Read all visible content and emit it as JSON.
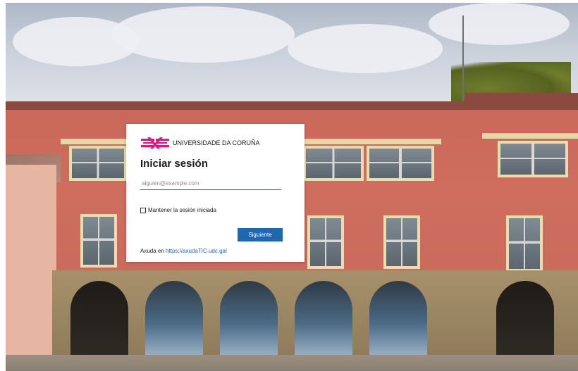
{
  "branding": {
    "university_name": "UNIVERSIDADE DA CORUÑA",
    "logo_color": "#e5127d"
  },
  "login": {
    "title": "Iniciar sesión",
    "email_placeholder": "alguien@example.com",
    "email_value": "",
    "keep_session_label": "Mantener la sesión iniciada",
    "keep_session_checked": false,
    "next_button_label": "Siguiente",
    "help_prefix": "Axuda en",
    "help_link_text": "https://axudaTIC.udc.gal"
  },
  "colors": {
    "accent": "#1f67b1",
    "card_background": "#ffffff",
    "text": "#1b1b1b"
  },
  "icons": {
    "logo": "udc-logo-icon",
    "checkbox": "checkbox-icon"
  }
}
